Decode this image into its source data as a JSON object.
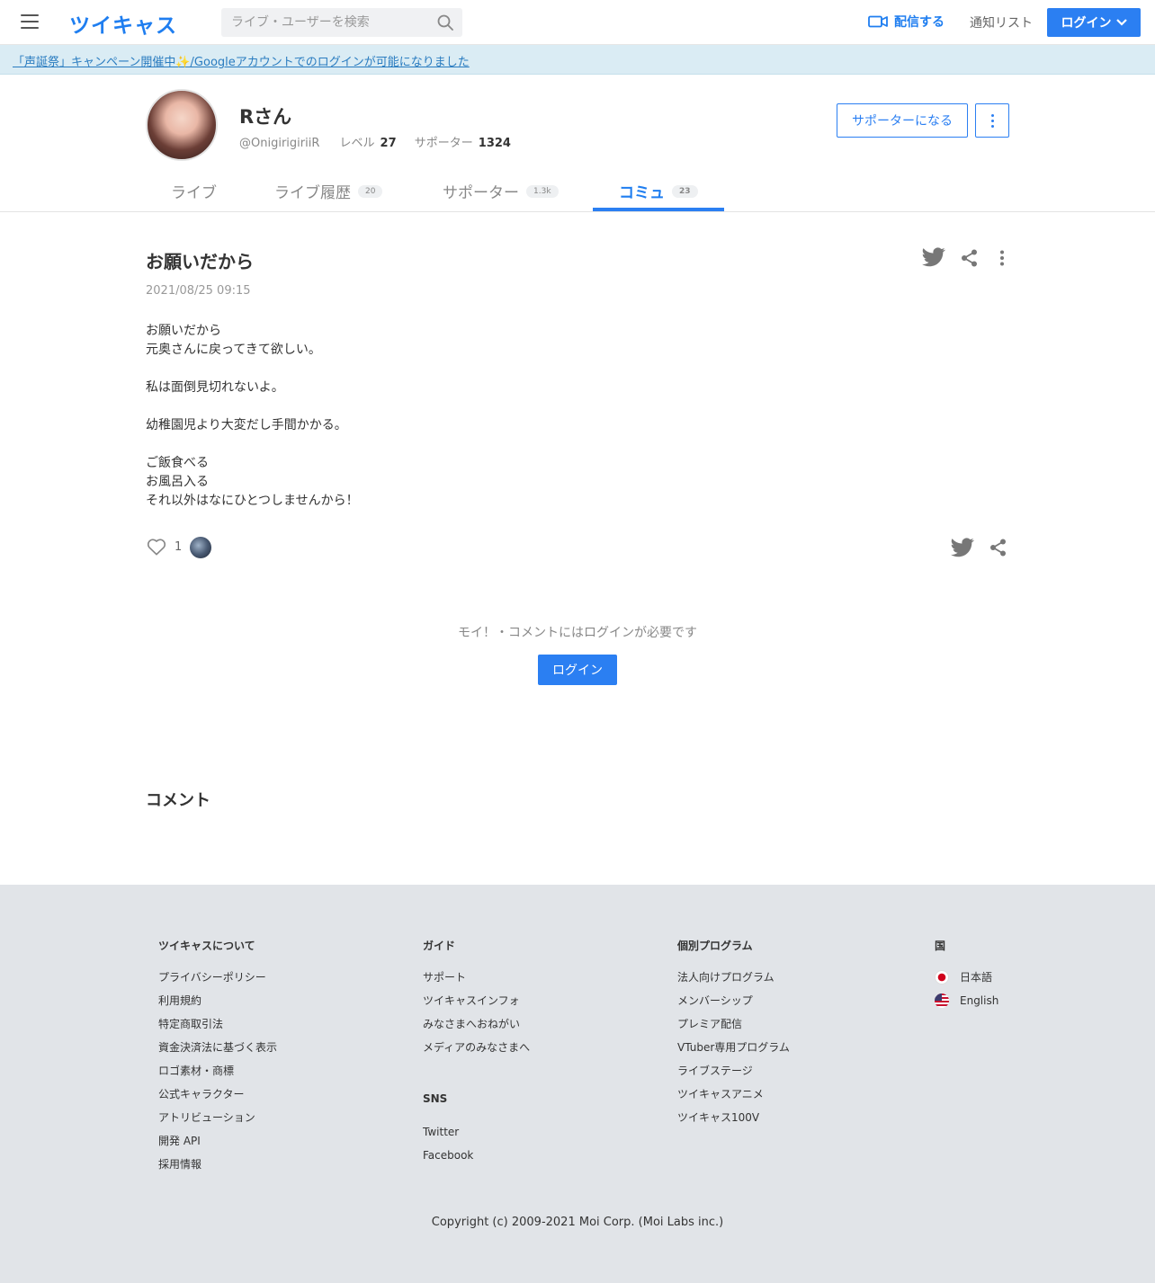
{
  "header": {
    "logo": "ツイキャス",
    "search_placeholder": "ライブ・ユーザーを検索",
    "broadcast_label": "配信する",
    "notify_label": "通知リスト",
    "login_label": "ログイン"
  },
  "banner": {
    "text": "「声誕祭」キャンペーン開催中✨/Googleアカウントでのログインが可能になりました"
  },
  "profile": {
    "name": "Rさん",
    "handle": "@OnigirigiriiR",
    "level_label": "レベル",
    "level": "27",
    "supporter_label": "サポーター",
    "supporter_count": "1324",
    "become_supporter": "サポーターになる"
  },
  "tabs": [
    {
      "label": "ライブ",
      "badge": ""
    },
    {
      "label": "ライブ履歴",
      "badge": "20"
    },
    {
      "label": "サポーター",
      "badge": "1.3k"
    },
    {
      "label": "コミュ",
      "badge": "23"
    }
  ],
  "post": {
    "title": "お願いだから",
    "date": "2021/08/25 09:15",
    "body": "お願いだから\n元奥さんに戻ってきて欲しい。\n\n私は面倒見切れないよ。\n\n幼稚園児より大変だし手間かかる。\n\nご飯食べる\nお風呂入る\nそれ以外はなにひとつしませんから！",
    "like_count": "1"
  },
  "login_prompt": {
    "message": "モイ！・コメントにはログインが必要です",
    "button": "ログイン"
  },
  "comments": {
    "heading": "コメント"
  },
  "footer": {
    "about": {
      "heading": "ツイキャスについて",
      "items": [
        "プライバシーポリシー",
        "利用規約",
        "特定商取引法",
        "資金決済法に基づく表示",
        "ロゴ素材・商標",
        "公式キャラクター",
        "アトリビューション",
        "開発 API",
        "採用情報"
      ]
    },
    "guide": {
      "heading": "ガイド",
      "items": [
        "サポート",
        "ツイキャスインフォ",
        "みなさまへおねがい",
        "メディアのみなさまへ"
      ]
    },
    "sns": {
      "heading": "SNS",
      "items": [
        "Twitter",
        "Facebook"
      ]
    },
    "programs": {
      "heading": "個別プログラム",
      "items": [
        "法人向けプログラム",
        "メンバーシップ",
        "プレミア配信",
        "VTuber専用プログラム",
        "ライブステージ",
        "ツイキャスアニメ",
        "ツイキャス100V"
      ]
    },
    "country": {
      "heading": "国",
      "items": [
        "日本語",
        "English"
      ]
    },
    "copyright": "Copyright (c) 2009-2021 Moi Corp. (Moi Labs inc.)"
  },
  "colors": {
    "accent": "#2b7ff2",
    "banner_bg": "#daecf4",
    "footer_bg": "#e1e4e8"
  }
}
